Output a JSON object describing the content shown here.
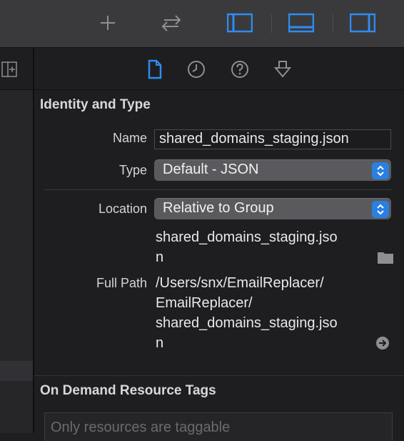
{
  "toolbar": {
    "colors": {
      "icon": "#8e8e93",
      "active": "#2f8cf0"
    },
    "icons": [
      "plus-icon",
      "swap-arrows-icon",
      "navigator-toggle-icon",
      "debug-area-toggle-icon",
      "inspector-toggle-icon"
    ]
  },
  "inspector_tabs": {
    "icons": [
      "file-icon",
      "clock-icon",
      "help-icon",
      "shield-download-icon"
    ],
    "active": "file-icon"
  },
  "identity": {
    "section_title": "Identity and Type",
    "name_label": "Name",
    "name_value": "shared_domains_staging.json",
    "type_label": "Type",
    "type_value": "Default - JSON",
    "location_label": "Location",
    "location_value": "Relative to Group",
    "location_file_line1": "shared_domains_staging.jso",
    "location_file_line2": "n",
    "full_path_label": "Full Path",
    "full_path_lines": [
      "/Users/snx/EmailReplacer/",
      "EmailReplacer/",
      "shared_domains_staging.jso",
      "n"
    ]
  },
  "tags": {
    "section_title": "On Demand Resource Tags",
    "placeholder": "Only resources are taggable"
  }
}
